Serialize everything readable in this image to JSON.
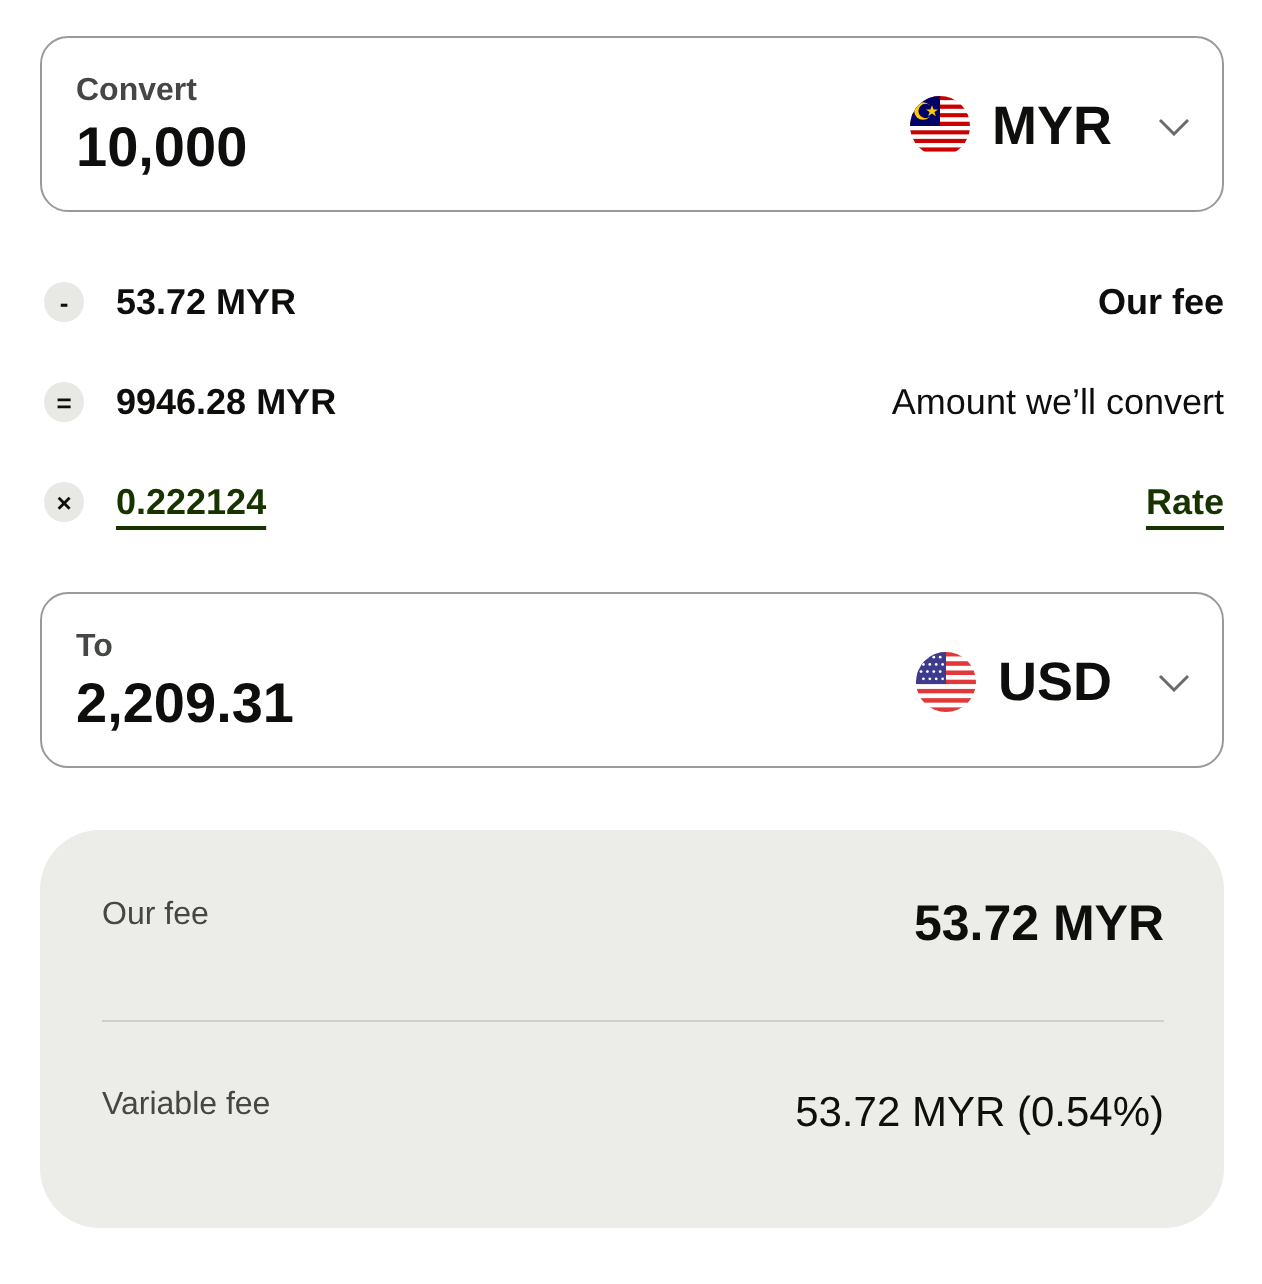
{
  "from_field": {
    "label": "Convert",
    "value": "10,000",
    "currency": "MYR"
  },
  "breakdown": [
    {
      "kind": "fee",
      "symbol": "-",
      "value": "53.72 MYR",
      "label": "Our fee"
    },
    {
      "kind": "amount",
      "symbol": "=",
      "value": "9946.28 MYR",
      "label": "Amount we’ll convert"
    },
    {
      "kind": "rate",
      "symbol": "×",
      "value": "0.222124",
      "label": "Rate"
    }
  ],
  "to_field": {
    "label": "To",
    "value": "2,209.31",
    "currency": "USD"
  },
  "fee_summary": {
    "rows": [
      {
        "kind": "total",
        "label": "Our fee",
        "value": "53.72 MYR"
      },
      {
        "kind": "detail",
        "label": "Variable fee",
        "value": "53.72 MYR (0.54%)"
      }
    ]
  }
}
